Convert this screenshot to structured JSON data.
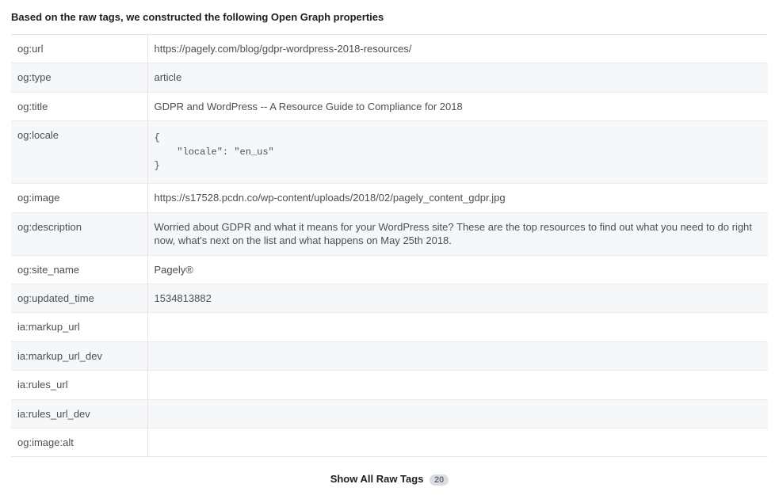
{
  "heading": "Based on the raw tags, we constructed the following Open Graph properties",
  "rows": [
    {
      "key": "og:url",
      "value": "https://pagely.com/blog/gdpr-wordpress-2018-resources/"
    },
    {
      "key": "og:type",
      "value": "article"
    },
    {
      "key": "og:title",
      "value": "GDPR and WordPress -- A Resource Guide to Compliance for 2018"
    },
    {
      "key": "og:locale",
      "value": "{\n    \"locale\": \"en_us\"\n}",
      "pre": true
    },
    {
      "key": "og:image",
      "value": "https://s17528.pcdn.co/wp-content/uploads/2018/02/pagely_content_gdpr.jpg"
    },
    {
      "key": "og:description",
      "value": "Worried about GDPR and what it means for your WordPress site? These are the top resources to find out what you need to do right now, what's next on the list and what happens on May 25th 2018."
    },
    {
      "key": "og:site_name",
      "value": "Pagely®"
    },
    {
      "key": "og:updated_time",
      "value": "1534813882"
    },
    {
      "key": "ia:markup_url",
      "value": ""
    },
    {
      "key": "ia:markup_url_dev",
      "value": ""
    },
    {
      "key": "ia:rules_url",
      "value": ""
    },
    {
      "key": "ia:rules_url_dev",
      "value": ""
    },
    {
      "key": "og:image:alt",
      "value": ""
    }
  ],
  "show_all": {
    "label": "Show All Raw Tags",
    "count": "20"
  }
}
